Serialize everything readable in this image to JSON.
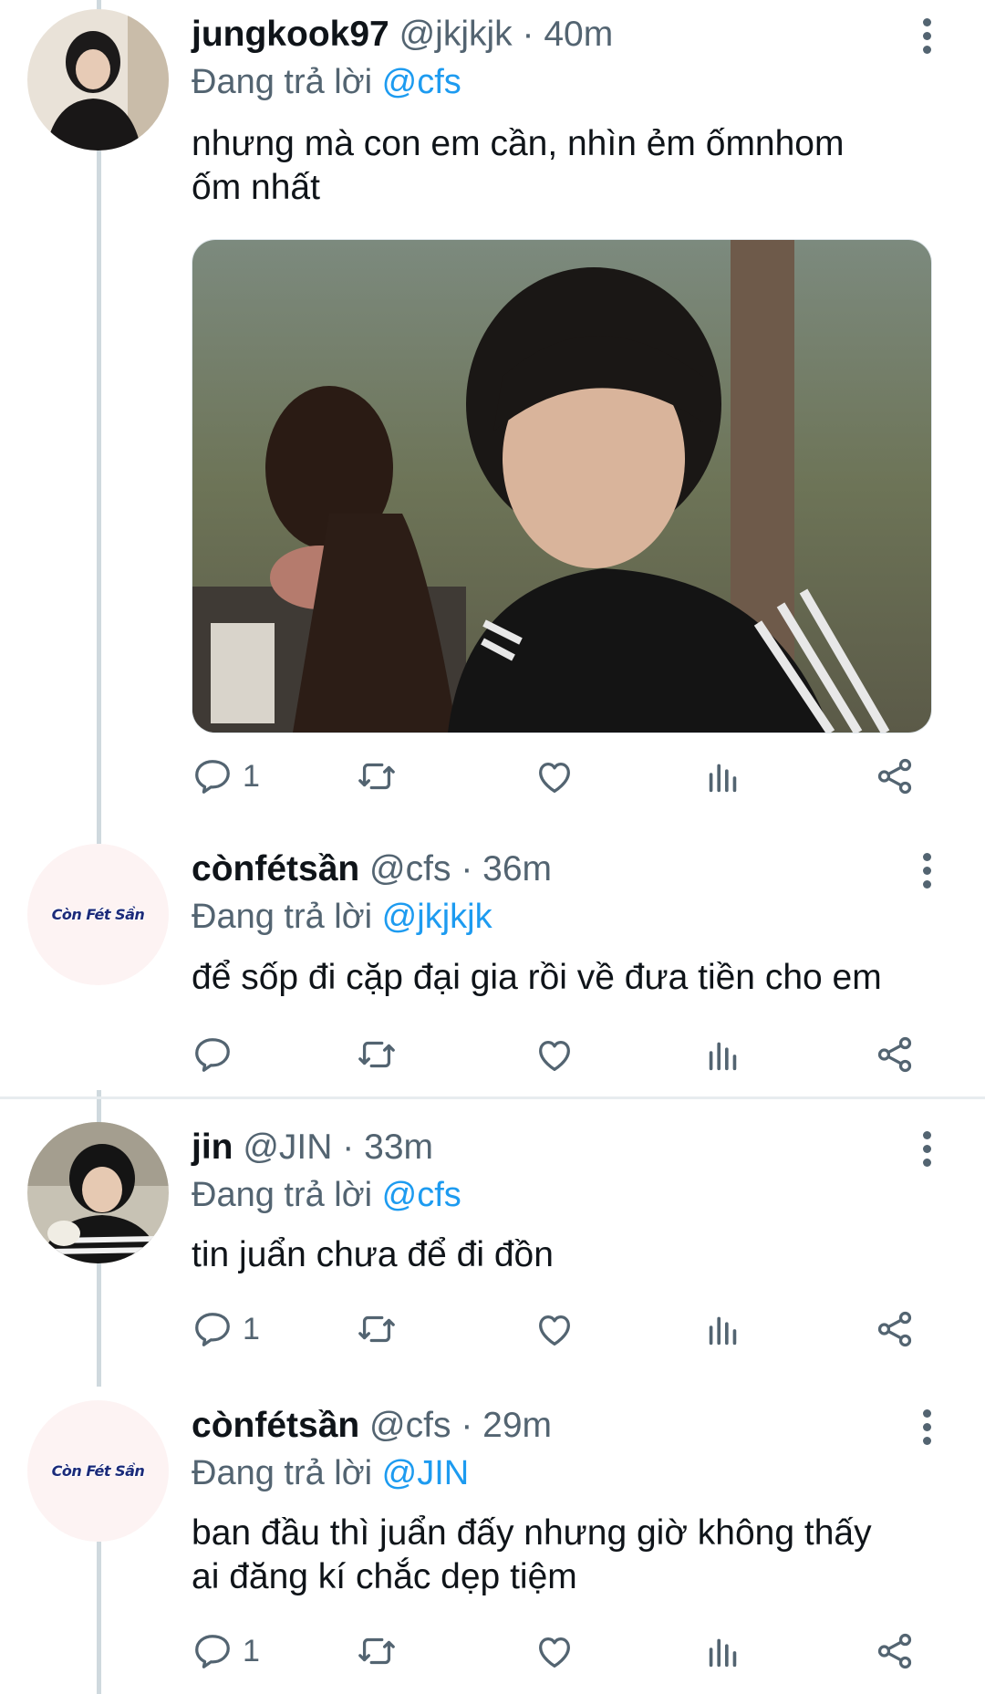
{
  "tweets": [
    {
      "name": "jungkook97",
      "handle": "@jkjkjk",
      "dot": "·",
      "time": "40m",
      "reply_prefix": "Đang trả lời",
      "reply_mention": "@cfs",
      "text_lines": [
        "nhưng mà con em cần, nhìn ẻm ốmnhom",
        "ốm nhất"
      ],
      "has_media": true,
      "replies": "1"
    },
    {
      "name": "cònfétsần",
      "handle": "@cfs",
      "dot": "·",
      "time": "36m",
      "reply_prefix": "Đang trả lời",
      "reply_mention": "@jkjkjk",
      "text_lines": [
        "để sốp đi cặp đại gia rồi về đưa tiền cho em"
      ],
      "avatar_text": "Còn Fét Sần",
      "replies": ""
    },
    {
      "name": "jin",
      "handle": "@JIN",
      "dot": "·",
      "time": "33m",
      "reply_prefix": "Đang trả lời",
      "reply_mention": "@cfs",
      "text_lines": [
        "tin juẩn chưa để đi đồn"
      ],
      "replies": "1"
    },
    {
      "name": "cònfétsần",
      "handle": "@cfs",
      "dot": "·",
      "time": "29m",
      "reply_prefix": "Đang trả lời",
      "reply_mention": "@JIN",
      "text_lines": [
        "ban đầu thì juẩn đấy nhưng giờ không thấy",
        "ai đăng kí chắc dẹp tiệm"
      ],
      "avatar_text": "Còn Fét Sần",
      "replies": "1"
    }
  ],
  "icons": {
    "reply": "reply-icon",
    "retweet": "retweet-icon",
    "like": "heart-icon",
    "views": "views-icon",
    "share": "share-icon",
    "more": "more-vertical-icon"
  },
  "colors": {
    "text": "#0f1419",
    "secondary": "#536471",
    "link": "#1d9bf0",
    "thread_line": "#cfd9de"
  }
}
